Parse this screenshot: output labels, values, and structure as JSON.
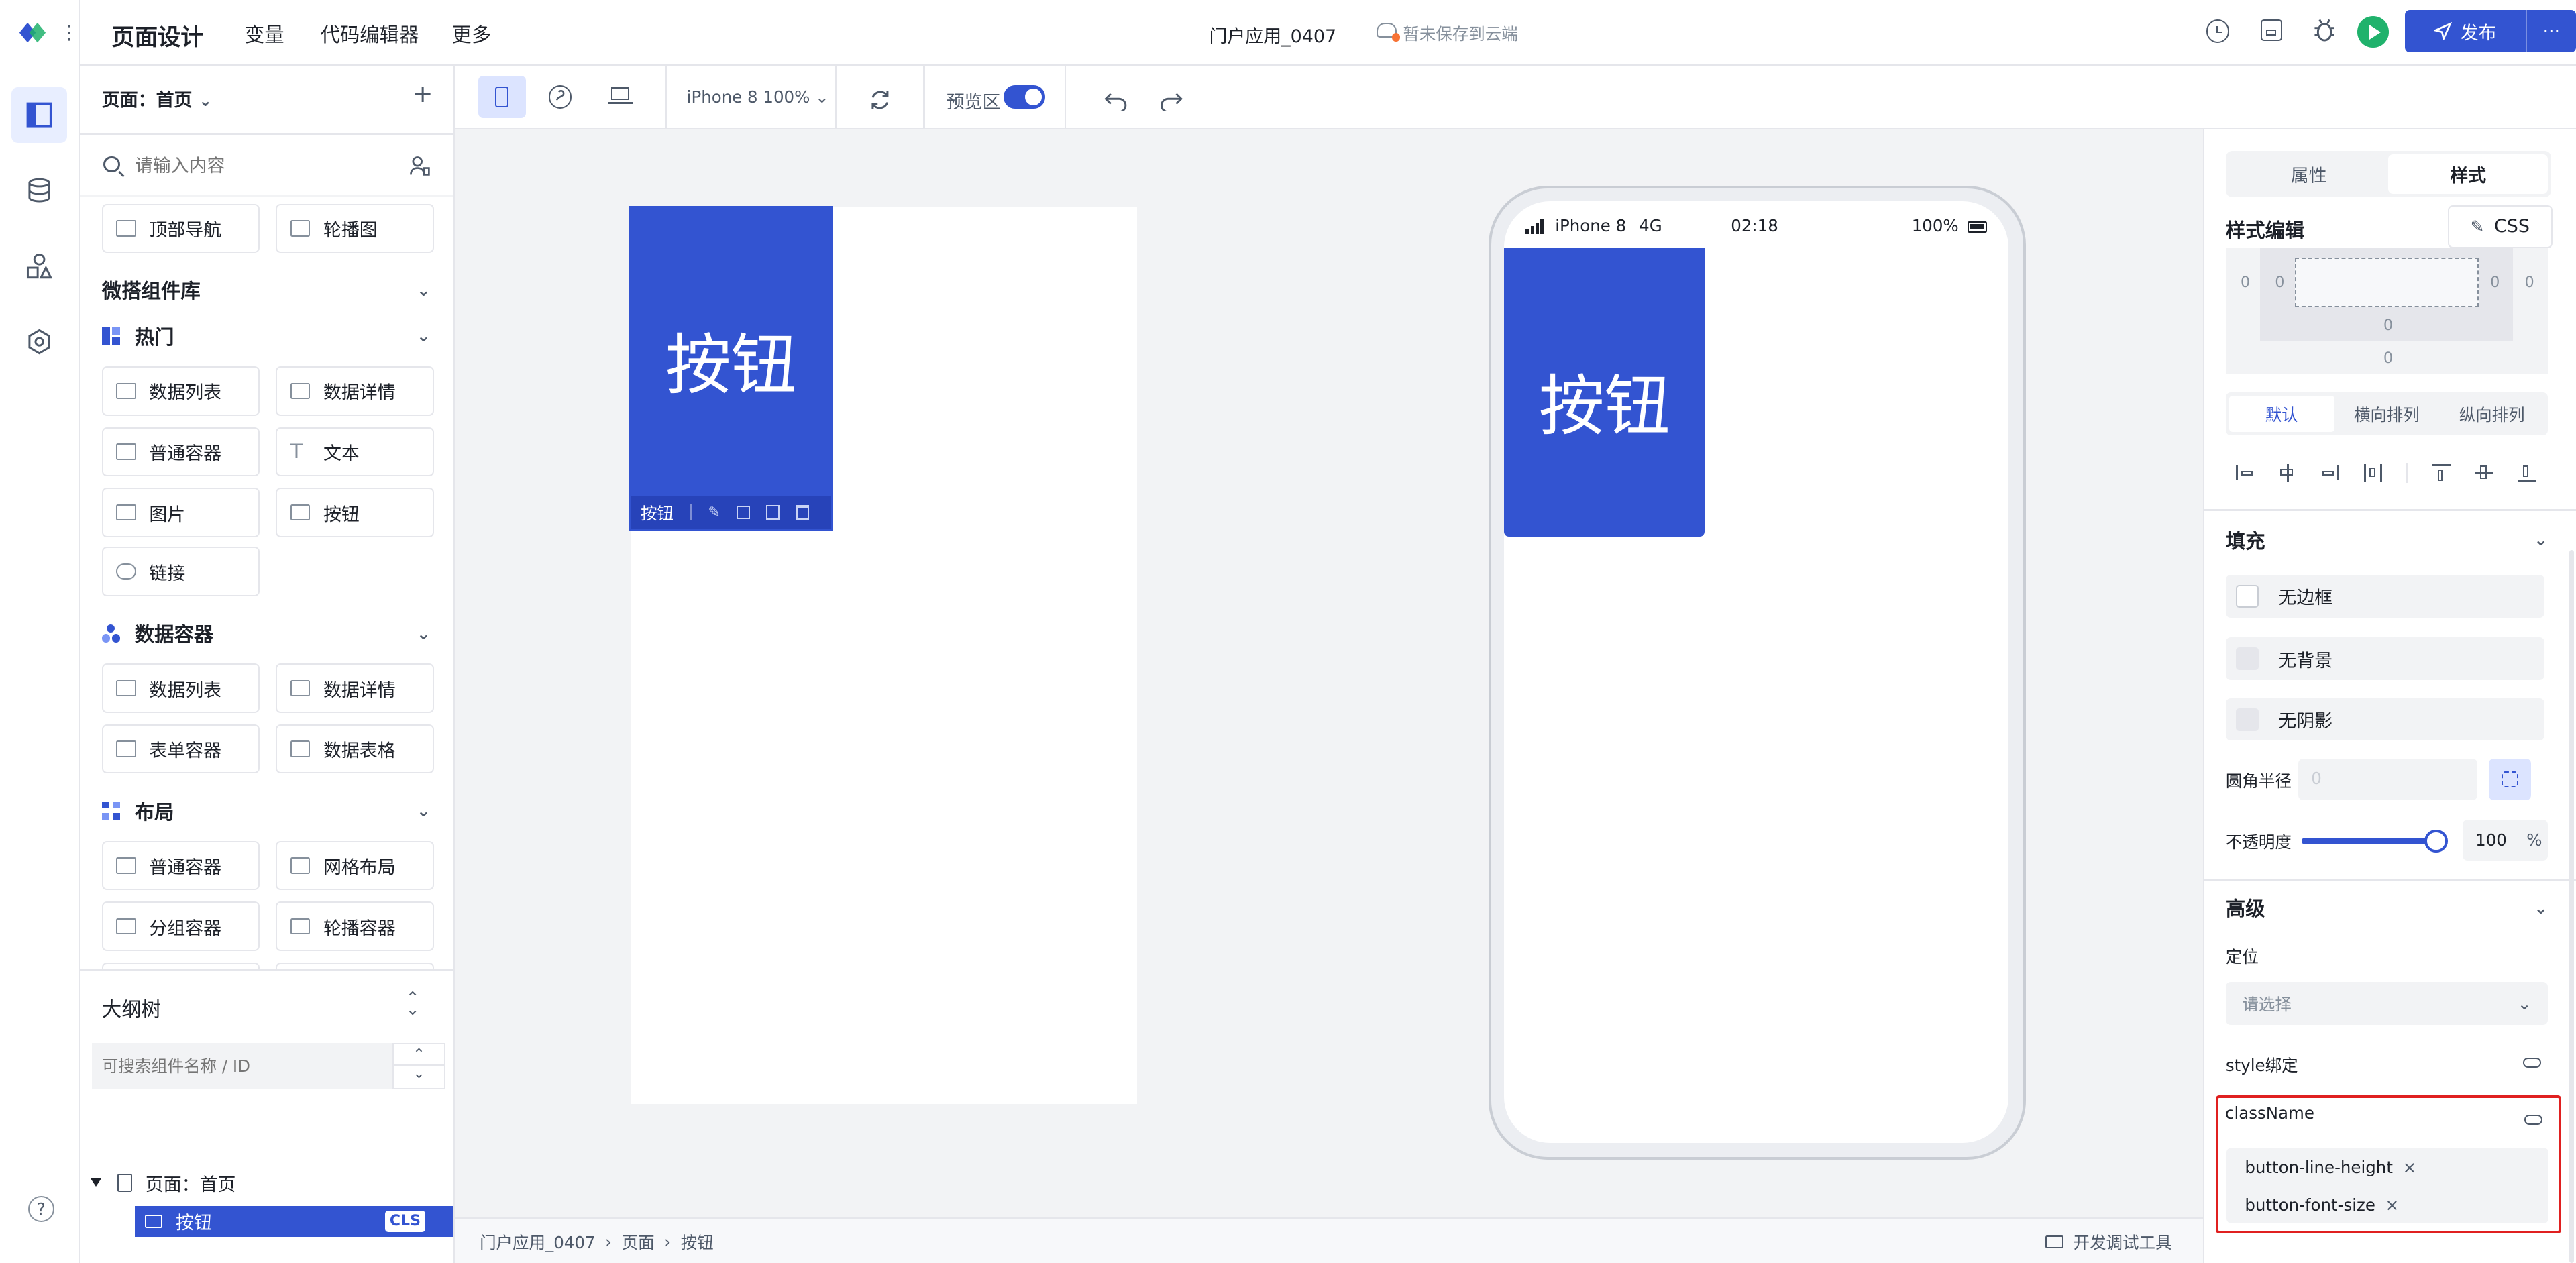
{
  "top": {
    "title": "页面设计",
    "nav": [
      "变量",
      "代码编辑器",
      "更多"
    ],
    "app_name": "门户应用_0407",
    "save_status": "暂未保存到云端",
    "publish": "发布",
    "more": "···"
  },
  "rail": {
    "icons": [
      "layout-icon",
      "database-icon",
      "components-icon",
      "settings-icon",
      "help-icon"
    ]
  },
  "left": {
    "page_label": "页面：首页",
    "add": "+",
    "search_placeholder": "请输入内容",
    "top_items": [
      "顶部导航",
      "轮播图"
    ],
    "library_title": "微搭组件库",
    "groups": [
      {
        "title": "热门",
        "items": [
          "数据列表",
          "数据详情",
          "普通容器",
          "文本",
          "图片",
          "按钮",
          "链接"
        ]
      },
      {
        "title": "数据容器",
        "items": [
          "数据列表",
          "数据详情",
          "表单容器",
          "数据表格"
        ]
      },
      {
        "title": "布局",
        "items": [
          "普通容器",
          "网格布局",
          "分组容器",
          "轮播容器"
        ]
      }
    ],
    "outline_title": "大纲树",
    "outline_search_placeholder": "可搜索组件名称 / ID",
    "tree_page": "页面：首页",
    "tree_button": "按钮",
    "tree_badge": "CLS"
  },
  "toolbar": {
    "device": "iPhone 8 100%",
    "preview_label": "预览区",
    "preview_on": true
  },
  "canvas": {
    "button_text": "按钮",
    "selected_label": "按钮"
  },
  "phone": {
    "carrier": "iPhone 8",
    "network": "4G",
    "time": "02:18",
    "battery": "100%",
    "button_text": "按钮"
  },
  "crumb": {
    "items": [
      "门户应用_0407",
      "页面",
      "按钮"
    ],
    "dev_tools": "开发调试工具"
  },
  "right": {
    "tabs": [
      "属性",
      "样式"
    ],
    "active_tab": "样式",
    "style_edit": "样式编辑",
    "css_button": "CSS",
    "box_values": [
      "0",
      "0",
      "0",
      "0",
      "0",
      "0"
    ],
    "layout_tabs": [
      "默认",
      "横向排列",
      "纵向排列"
    ],
    "fill_title": "填充",
    "fill_items": [
      "无边框",
      "无背景",
      "无阴影"
    ],
    "radius_label": "圆角半径",
    "radius_value": "0",
    "opacity_label": "不透明度",
    "opacity_value": "100",
    "opacity_unit": "%",
    "opacity_level": 1.0,
    "advanced_title": "高级",
    "position_label": "定位",
    "position_placeholder": "请选择",
    "style_bind_label": "style绑定",
    "classname_label": "className",
    "classname_tags": [
      "button-line-height",
      "button-font-size"
    ]
  },
  "colors": {
    "primary": "#3354d1",
    "highlight_border": "#e02020"
  }
}
